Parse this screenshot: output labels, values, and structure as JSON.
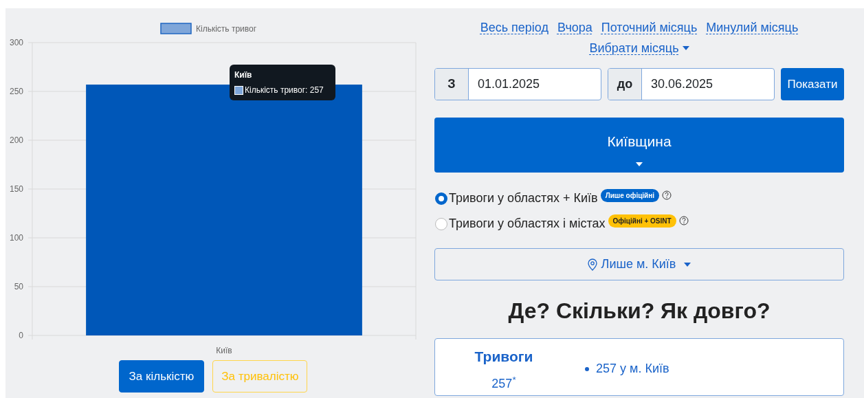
{
  "chart": {
    "chart_data": {
      "type": "bar",
      "grid": true,
      "categories": [
        "Київ"
      ],
      "series": [
        {
          "name": "Кількість тривог",
          "color": "#0057b8",
          "values": [
            257
          ]
        }
      ],
      "ylim": [
        0,
        300
      ],
      "yticks": [
        0,
        50,
        100,
        150,
        200,
        250,
        300
      ]
    },
    "tooltip": {
      "title": "Київ",
      "text": "Кількість тривог: 257"
    }
  },
  "mode_buttons": [
    {
      "label": "За кількістю",
      "selected": true
    },
    {
      "label": "За тривалістю",
      "selected": false
    }
  ],
  "period_links": [
    "Весь період",
    "Вчора",
    "Поточний місяць",
    "Минулий місяць"
  ],
  "month_picker": "Вибрати місяць",
  "date_from": {
    "prefix": "З",
    "value": "01.01.2025"
  },
  "date_to": {
    "prefix": "до",
    "value": "30.06.2025"
  },
  "show_button": "Показати",
  "region_button": "Київщина",
  "alert_types": [
    {
      "label": "Тривоги у областях + Київ",
      "selected": true,
      "badge": {
        "text": "Лише офіційні",
        "kind": "primary"
      }
    },
    {
      "label": "Тривоги у областях і містах",
      "selected": false,
      "badge": {
        "text": "Офіційні + OSINT",
        "kind": "warning"
      }
    }
  ],
  "city_dropdown": "Лише м. Київ",
  "heading": "Де? Скільки? Як довго?",
  "summary": {
    "title": "Тривоги",
    "total": "257$^{*}$",
    "items": [
      "257 у м. Київ"
    ]
  }
}
